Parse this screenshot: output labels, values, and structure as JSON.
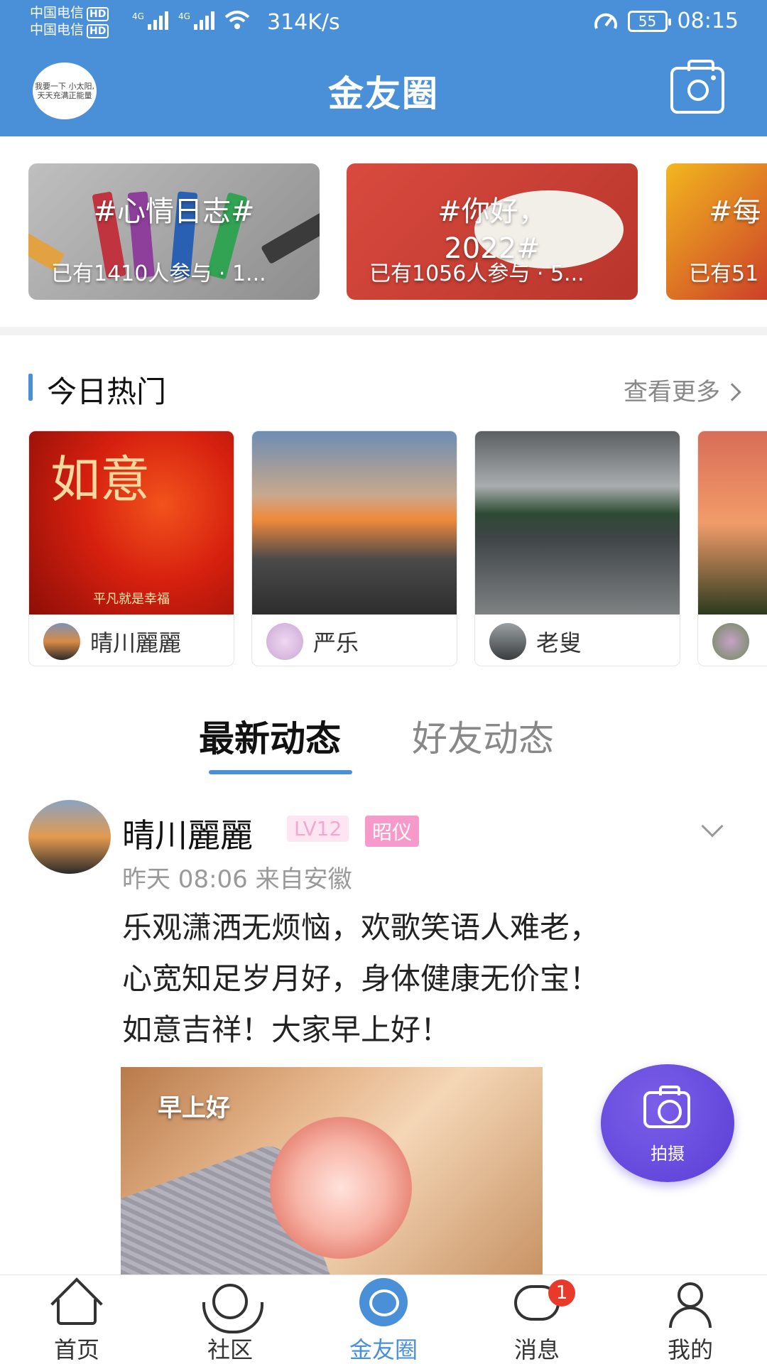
{
  "status_bar": {
    "carrier_1": "中国电信",
    "carrier_2": "中国电信",
    "hd": "HD",
    "network": "4G",
    "speed": "314K/s",
    "battery": "55",
    "time": "08:15"
  },
  "header": {
    "title": "金友圈",
    "avatar_text": "我要一下 小太阳, 天天充满正能量"
  },
  "topics": [
    {
      "title": "#心情日志#",
      "count": "已有1410人参与 · 1..."
    },
    {
      "title": "#你好，2022#",
      "count": "已有1056人参与 · 5..."
    },
    {
      "title": "#每",
      "count": "已有51"
    }
  ],
  "hot": {
    "title": "今日热门",
    "more": "查看更多",
    "items": [
      {
        "user": "晴川麗麗",
        "img_text": "如意",
        "img_sub": "平凡就是幸福"
      },
      {
        "user": "严乐"
      },
      {
        "user": "老叟"
      },
      {
        "user": ""
      }
    ]
  },
  "tabs": {
    "latest": "最新动态",
    "friends": "好友动态"
  },
  "post": {
    "author": "晴川麗麗",
    "level": "LV12",
    "rank": "昭仪",
    "meta": "昨天 08:06 来自安徽",
    "lines": [
      "乐观潇洒无烦恼，欢歌笑语人难老，",
      "心宽知足岁月好，身体健康无价宝！",
      "如意吉祥！大家早上好！"
    ],
    "image_caption": "早上好"
  },
  "fab": {
    "label": "拍摄"
  },
  "nav": {
    "home": "首页",
    "community": "社区",
    "circle": "金友圈",
    "messages": "消息",
    "messages_badge": "1",
    "me": "我的"
  },
  "colors": {
    "primary": "#4a90d9",
    "fab": "#5a3ed6",
    "badge_red": "#e8392a",
    "rank_pink": "#f59acb"
  }
}
